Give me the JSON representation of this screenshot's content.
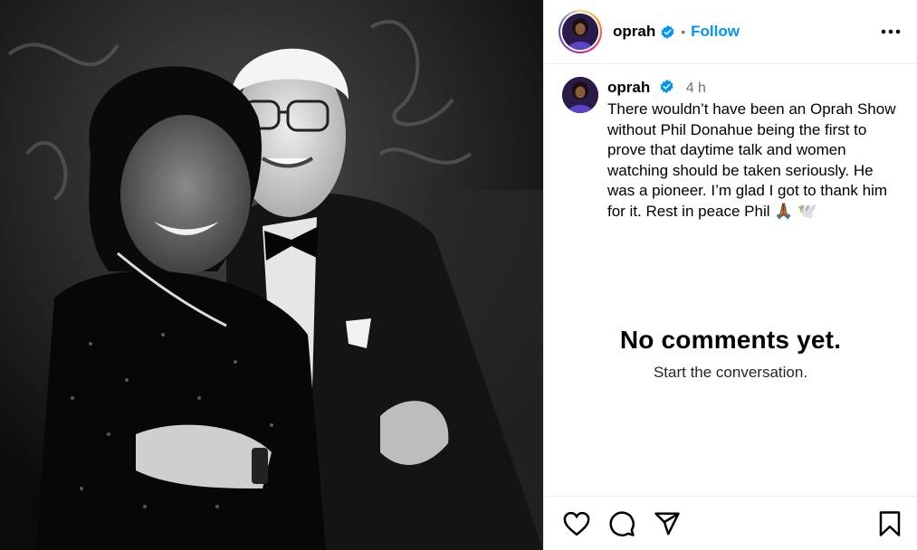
{
  "post": {
    "account": {
      "username": "oprah",
      "verified": true,
      "follow_label": "Follow",
      "separator": "•"
    },
    "caption": {
      "username": "oprah",
      "time": "4 h",
      "text": "There wouldn’t have been an Oprah Show without Phil Donahue being the first to prove that daytime talk and women watching should be taken seriously. He was a pioneer. I’m glad I got to thank him for it. Rest in peace Phil 🙏🏾 🕊️"
    },
    "comments": {
      "empty_title": "No comments yet.",
      "empty_subtitle": "Start the conversation."
    },
    "icons": {
      "more": "more-options-icon",
      "like": "heart-icon",
      "comment": "comment-icon",
      "share": "share-icon",
      "save": "bookmark-icon",
      "verified": "verified-badge-icon"
    },
    "colors": {
      "link": "#0095f6",
      "verified": "#0095f6",
      "muted": "#737373",
      "divider": "#efefef"
    }
  }
}
